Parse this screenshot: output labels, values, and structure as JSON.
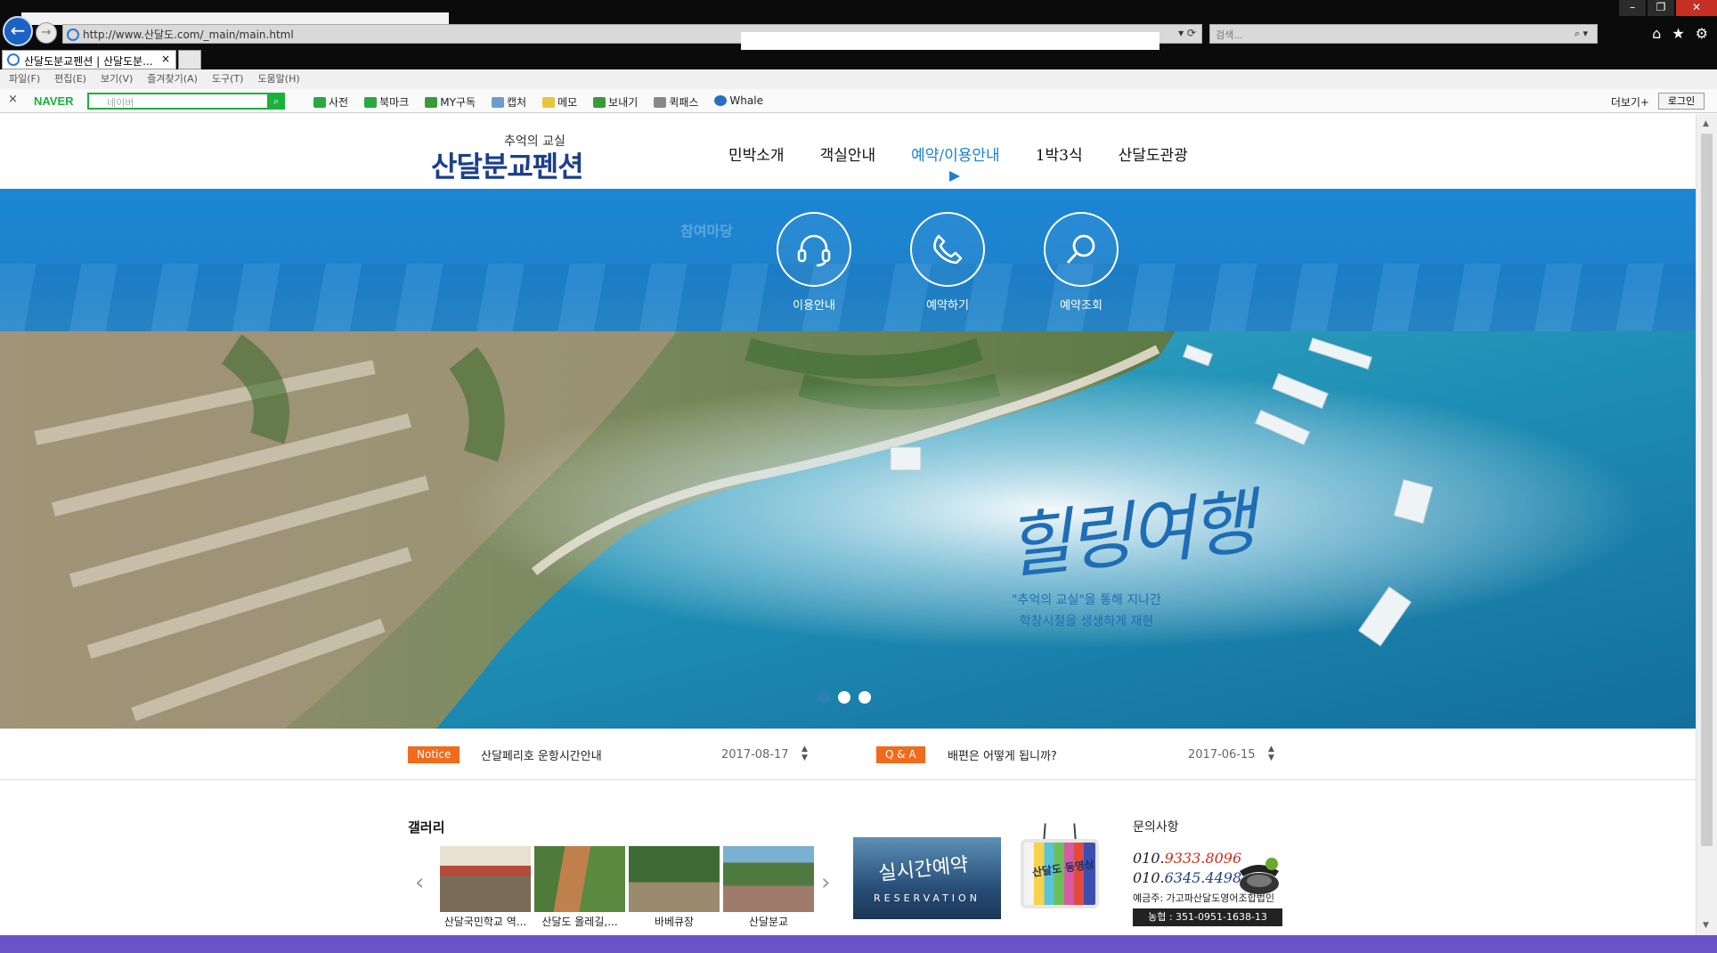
{
  "browser": {
    "url": "http://www.산달도.com/_main/main.html",
    "search_placeholder": "검색...",
    "tab_title": "산달도분교펜션 | 산달도분...",
    "tab_close": "×",
    "menus": [
      "파일(F)",
      "편집(E)",
      "보기(V)",
      "즐겨찾기(A)",
      "도구(T)",
      "도움말(H)"
    ]
  },
  "naver_toolbar": {
    "close": "×",
    "logo": "NAVER",
    "search_placeholder": "네이버",
    "items": [
      "사전",
      "북마크",
      "MY구독",
      "캡처",
      "메모",
      "보내기",
      "퀵패스",
      "Whale"
    ],
    "more": "더보기+",
    "login": "로그인"
  },
  "site": {
    "logo_sub": "추억의 교실",
    "logo_main": "산달분교펜션",
    "nav": [
      "민박소개",
      "객실안내",
      "예약/이용안내",
      "1박3식",
      "산달도관광"
    ],
    "active_nav": 2,
    "submenu_category": "참여마당",
    "submenu": [
      {
        "label": "이용안내",
        "icon": "headset-icon"
      },
      {
        "label": "예약하기",
        "icon": "phone-icon"
      },
      {
        "label": "예약조회",
        "icon": "search-icon"
      }
    ]
  },
  "hero": {
    "title": "힐링여행",
    "subtitle_line1": "\"추억의 교실\"을 통해 지나간",
    "subtitle_line2": "학창시절을 생생하게 재현",
    "slide_count": 3,
    "active_slide": 0
  },
  "notice": {
    "badge": "Notice",
    "text": "산달페리호 운항시간안내",
    "date": "2017-08-17"
  },
  "qna": {
    "badge": "Q & A",
    "text": "배편은 어떻게 됩니까?",
    "date": "2017-06-15"
  },
  "gallery": {
    "title": "갤러리",
    "items": [
      {
        "caption": "산달국민학교 역..."
      },
      {
        "caption": "산달도 올레길,..."
      },
      {
        "caption": "바베큐장"
      },
      {
        "caption": "산달분교"
      }
    ]
  },
  "reservation_banner": {
    "title": "실시간예약",
    "subtitle": "RESERVATION"
  },
  "video_banner": {
    "label": "산달도 동영상"
  },
  "contact": {
    "title": "문의사항",
    "phone1_prefix": "010.",
    "phone1": "9333.8096",
    "phone2_prefix": "010.",
    "phone2": "6345.4498",
    "account_holder": "예금주: 가고파산달도영어조합법인",
    "bank": "농협 : 351-0951-1638-13"
  },
  "colors": {
    "accent": "#1c7fd0",
    "notice_badge": "#f26a1b",
    "naver_green": "#19b23a"
  }
}
